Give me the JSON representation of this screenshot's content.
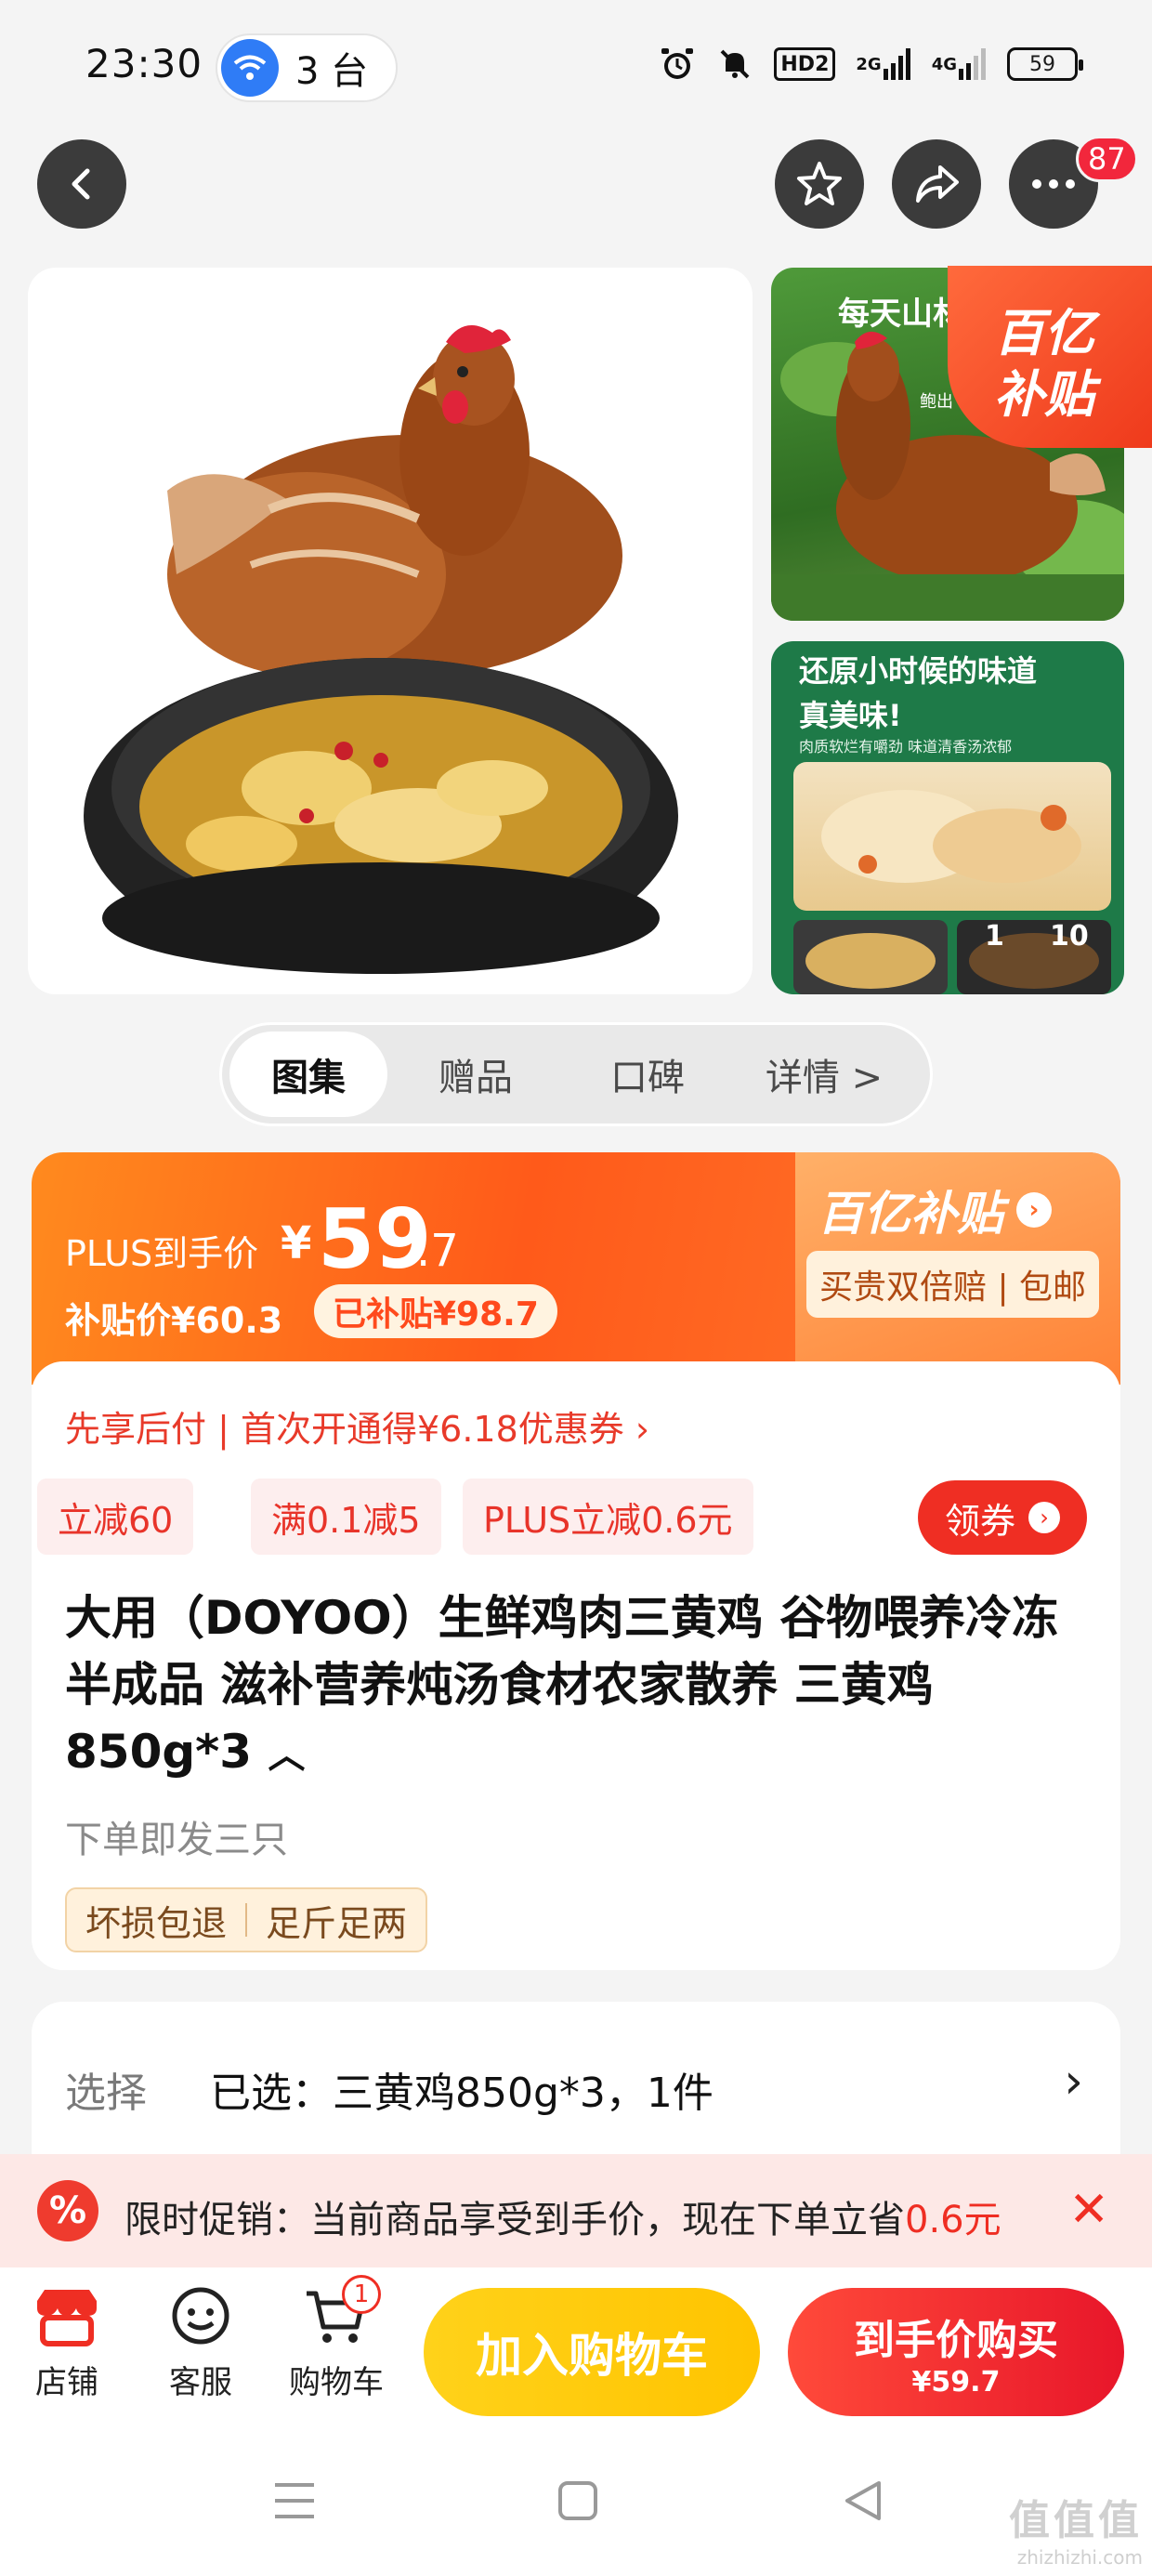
{
  "status_bar": {
    "time": "23:30",
    "hotspot_text": "3 台",
    "network_2g": "2G",
    "network_4g": "4G",
    "hd_label": "HD2",
    "battery": "59"
  },
  "header": {
    "notification_count": "87"
  },
  "gallery": {
    "thumb1_text": "每天山林",
    "thumb1_sub": "鲍出",
    "subsidy_badge_line1": "百亿",
    "subsidy_badge_line2": "补贴",
    "thumb2_title_line1": "还原小时候的味道",
    "thumb2_title_line2": "真美味!",
    "thumb2_sub": "肉质软烂有嚼劲 味道清香汤浓郁",
    "page_index": "1",
    "page_total": "10"
  },
  "tabs": [
    {
      "label": "图集"
    },
    {
      "label": "赠品"
    },
    {
      "label": "口碑"
    },
    {
      "label": "详情 >"
    }
  ],
  "price": {
    "plus_label": "PLUS到手价",
    "currency": "¥",
    "integer": "59",
    "decimal": ".7",
    "subsidy_price": "补贴价¥60.3",
    "subsidized": "已补贴¥98.7",
    "brand_label": "百亿补贴",
    "guarantee": "买贵双倍赔 | 包邮"
  },
  "promo_line": "先享后付 | 首次开通得¥6.18优惠券 ›",
  "coupons": [
    "立减60",
    "满0.1减5",
    "PLUS立减0.6元"
  ],
  "get_coupon_label": "领券",
  "product": {
    "title": "大用（DOYOO）生鲜鸡肉三黄鸡 谷物喂养冷冻半成品 滋补营养炖汤食材农家散养 三黄鸡850g*3",
    "shipping_note": "下单即发三只",
    "tags": [
      "坏损包退",
      "足斤足两"
    ]
  },
  "selection": {
    "label": "选择",
    "value": "已选：三黄鸡850g*3，1件"
  },
  "limited_promo": {
    "icon_text": "%",
    "text": "限时促销：当前商品享受到手价，现在下单立省",
    "amount": "0.6元"
  },
  "bottom_bar": {
    "shop_label": "店铺",
    "service_label": "客服",
    "cart_label": "购物车",
    "cart_count": "1",
    "add_to_cart": "加入购物车",
    "buy_line1": "到手价购买",
    "buy_line2": "¥59.7"
  },
  "watermark": {
    "main": "值值值",
    "sub": "zhizhizhi.com"
  },
  "colors": {
    "accent_red": "#ef2e23",
    "accent_orange": "#ff5a1a",
    "accent_yellow": "#ffc400"
  }
}
